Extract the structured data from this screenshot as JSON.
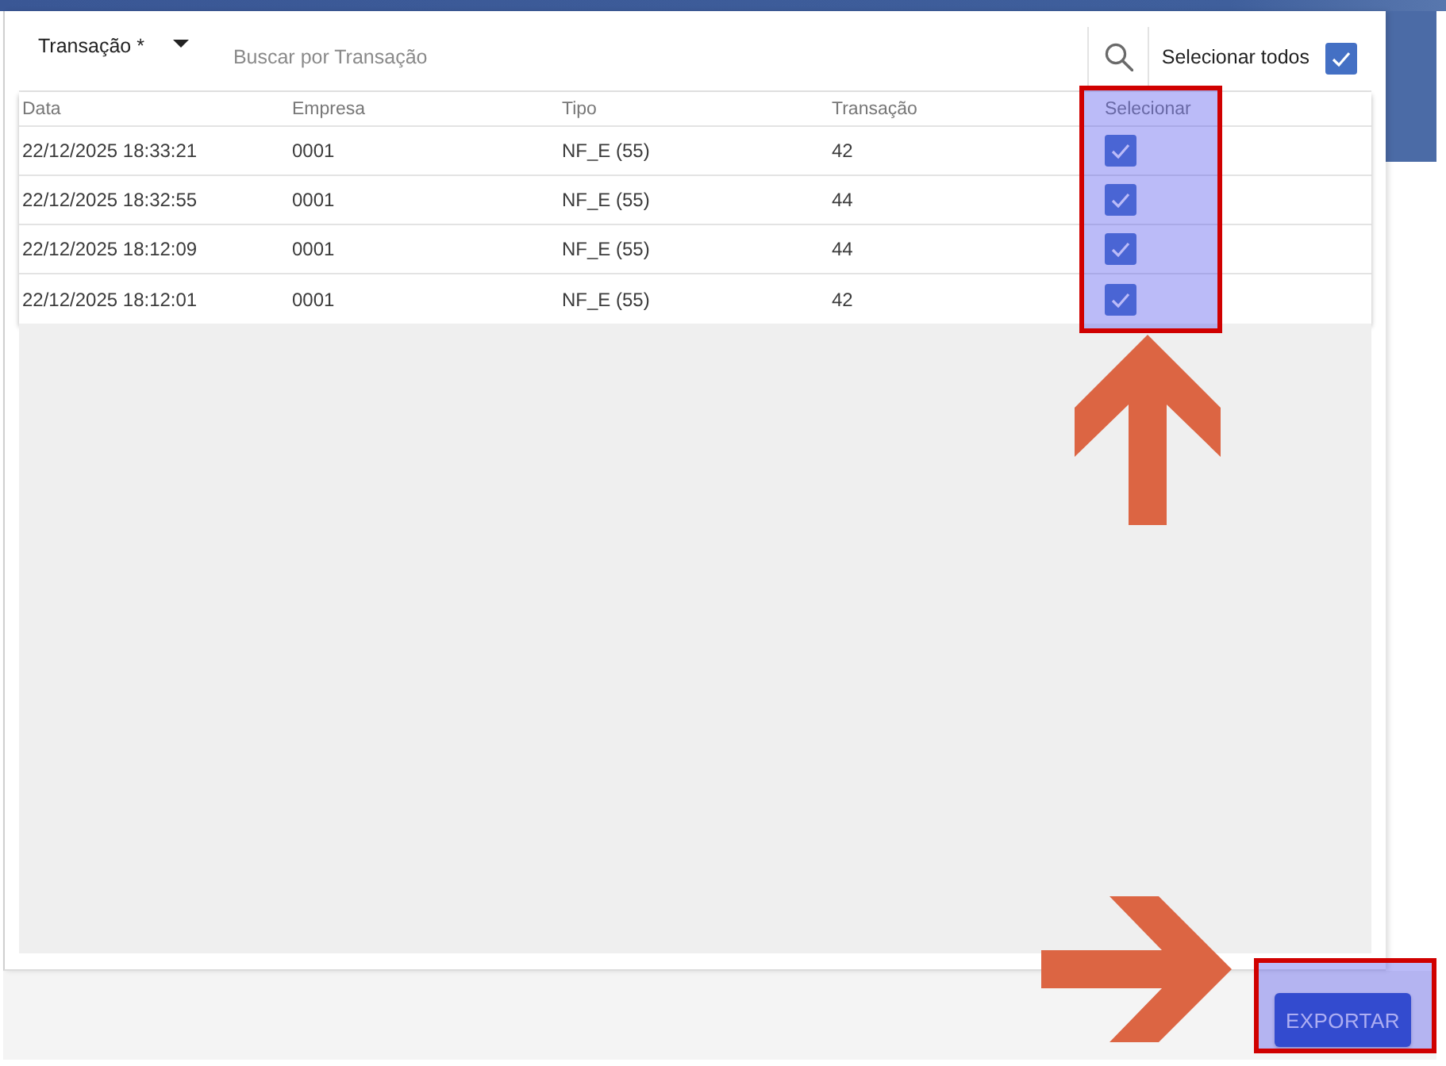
{
  "toolbar": {
    "filter": {
      "label": "Transação *"
    },
    "search": {
      "placeholder": "Buscar por Transação"
    },
    "select_all": {
      "label": "Selecionar todos",
      "checked": true
    }
  },
  "table": {
    "columns": [
      {
        "label": "Data"
      },
      {
        "label": "Empresa"
      },
      {
        "label": "Tipo"
      },
      {
        "label": "Transação"
      },
      {
        "label": "Selecionar",
        "highlighted": true
      }
    ],
    "rows": [
      {
        "cells": [
          "22/12/2025 18:33:21",
          "0001",
          "NF_E (55)",
          "42"
        ],
        "checked": true
      },
      {
        "cells": [
          "22/12/2025 18:32:55",
          "0001",
          "NF_E (55)",
          "44"
        ],
        "checked": true
      },
      {
        "cells": [
          "22/12/2025 18:12:09",
          "0001",
          "NF_E (55)",
          "44"
        ],
        "checked": true
      },
      {
        "cells": [
          "22/12/2025 18:12:01",
          "0001",
          "NF_E (55)",
          "42"
        ],
        "checked": true
      }
    ]
  },
  "footer": {
    "buttons": [
      {
        "label": "EXPORTAR",
        "highlighted": true
      }
    ]
  }
}
